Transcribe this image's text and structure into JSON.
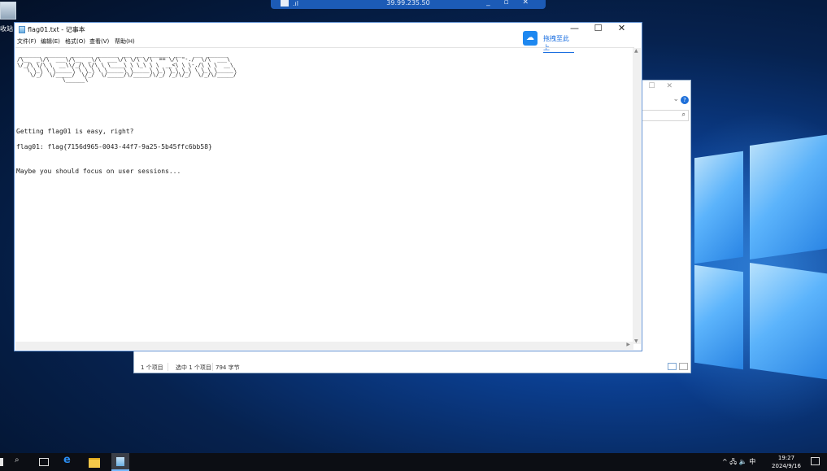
{
  "desktop": {
    "recycle_bin_label": "收站",
    "remote_bar": {
      "ip": "39.99.235.50",
      "controls": "_ ▫ ✕"
    }
  },
  "explorer": {
    "status_items": "1 个项目",
    "status_selected": "选中 1 个项目",
    "status_size": "794 字节"
  },
  "notepad": {
    "title": "flag01.txt - 记事本",
    "window_controls": [
      "—",
      "☐",
      "✕"
    ],
    "baidu_button": "拖拽至此上",
    "menu": [
      "文件(F)",
      "编辑(E)",
      "格式(O)",
      "查看(V)",
      "帮助(H)"
    ],
    "content": {
      "banner": " ______  ______  ______  ______  __  __  ______  __    __  ______\n/\\__  _\\/\\  ___\\/\\__  _\\/\\  ___\\/\\ \\/\\ \\/\\  == \\/\\ \"-./  \\/\\  ___\\\n\\/_/\\ \\/\\ \\  __\\\\/_/\\ \\/\\ \\ \\____\\ \\ \\_\\ \\ \\  __<\\ \\ \\-./\\ \\ \\  __\\\n   \\ \\_\\ \\ \\_____\\ \\ \\_\\ \\ \\_____\\ \\_____\\ \\_\\ \\_\\ \\_\\ \\ \\_\\ \\_____\\\n    \\/_/  \\/_____/  \\/_/  \\/_____/\\/_____/\\/_/ /_/\\/_/  \\/_/\\/_____/\n              \\______\\",
      "line1": "Getting flag01 is easy, right?",
      "line2": "flag01: flag{7156d965-0043-44f7-9a25-5b45ffc6bb58}",
      "line3": "Maybe you should focus on user sessions..."
    }
  },
  "taskbar": {
    "tray_icons": "^ 🖧 🔈 中",
    "time": "19:27",
    "date": "2024/9/16"
  }
}
